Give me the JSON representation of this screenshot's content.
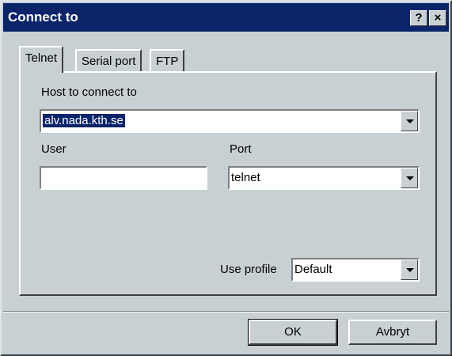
{
  "window": {
    "title": "Connect to",
    "help_button": "?",
    "close_button": "×"
  },
  "tabs": [
    {
      "label": "Telnet",
      "active": true
    },
    {
      "label": "Serial port",
      "active": false
    },
    {
      "label": "FTP",
      "active": false
    }
  ],
  "form": {
    "host_label": "Host to connect to",
    "host_value": "alv.nada.kth.se",
    "user_label": "User",
    "user_value": "",
    "port_label": "Port",
    "port_value": "telnet",
    "profile_label": "Use profile",
    "profile_value": "Default"
  },
  "buttons": {
    "ok": "OK",
    "cancel": "Avbryt"
  }
}
